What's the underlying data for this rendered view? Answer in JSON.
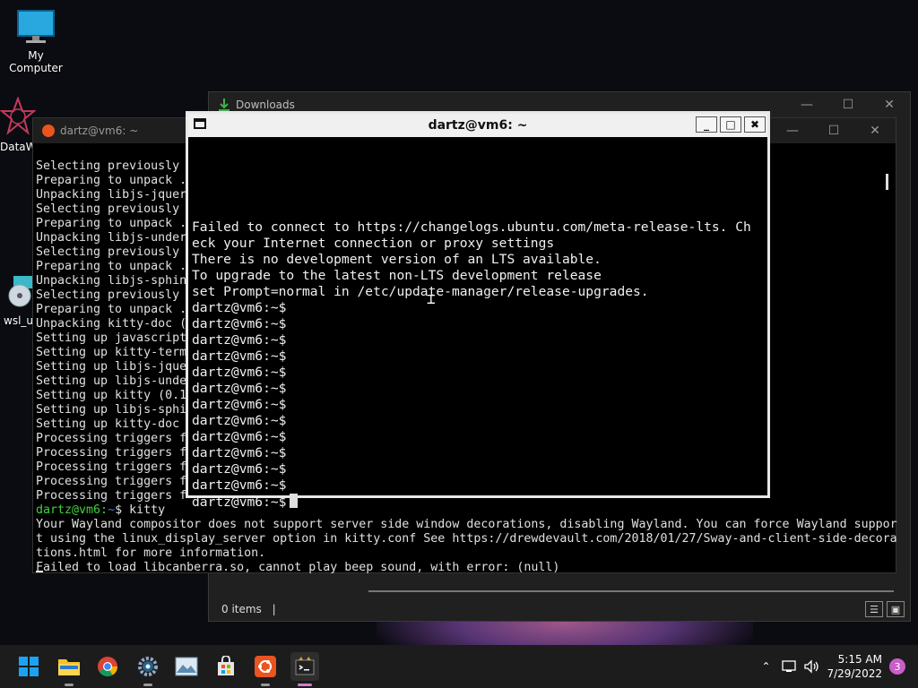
{
  "desktop": {
    "icons": [
      {
        "label": "My Computer"
      },
      {
        "label": "DataW"
      },
      {
        "label": "wsl_up"
      }
    ]
  },
  "explorer": {
    "title": "Downloads",
    "status": "0 items",
    "status_sep": "|"
  },
  "back_terminal": {
    "title": "dartz@vm6: ~",
    "lines_top": [
      "Selecting previously",
      "Preparing to unpack .",
      "Unpacking libjs-jquer",
      "Selecting previously",
      "Preparing to unpack .",
      "Unpacking libjs-under",
      "Selecting previously",
      "Preparing to unpack .",
      "Unpacking libjs-sphin",
      "Selecting previously",
      "Preparing to unpack .",
      "Unpacking kitty-doc (",
      "Setting up javascript",
      "Setting up kitty-term",
      "Setting up libjs-jque",
      "Setting up libjs-unde",
      "Setting up kitty (0.1",
      "Setting up libjs-sphi",
      "Setting up kitty-doc",
      "Processing triggers f",
      "Processing triggers f",
      "Processing triggers f",
      "Processing triggers f",
      "Processing triggers f"
    ],
    "prompt": "dartz@vm6:",
    "prompt_path": "~",
    "command": "$ kitty",
    "lines_bottom": [
      "Your Wayland compositor does not support server side window decorations, disabling Wayland. You can force Wayland suppor",
      "t using the linux_display_server option in kitty.conf See https://drewdevault.com/2018/01/27/Sway-and-client-side-decora",
      "tions.html for more information.",
      "Failed to load libcanberra.so, cannot play beep sound, with error: (null)"
    ]
  },
  "front_terminal": {
    "title": "dartz@vm6: ~",
    "lines": [
      "Failed to connect to https://changelogs.ubuntu.com/meta-release-lts. Ch",
      "eck your Internet connection or proxy settings",
      "There is no development version of an LTS available.",
      "To upgrade to the latest non-LTS development release",
      "set Prompt=normal in /etc/update-manager/release-upgrades.",
      "dartz@vm6:~$",
      "dartz@vm6:~$",
      "dartz@vm6:~$",
      "dartz@vm6:~$",
      "dartz@vm6:~$",
      "dartz@vm6:~$",
      "dartz@vm6:~$",
      "dartz@vm6:~$",
      "dartz@vm6:~$",
      "dartz@vm6:~$",
      "dartz@vm6:~$",
      "dartz@vm6:~$"
    ],
    "last_prompt": "dartz@vm6:~$"
  },
  "taskbar": {
    "apps": [
      "start-icon",
      "file-explorer-icon",
      "chrome-icon",
      "settings-icon",
      "photos-icon",
      "store-icon",
      "ubuntu-icon",
      "terminal-icon"
    ],
    "time": "5:15 AM",
    "date": "7/29/2022",
    "notifications": "3"
  }
}
